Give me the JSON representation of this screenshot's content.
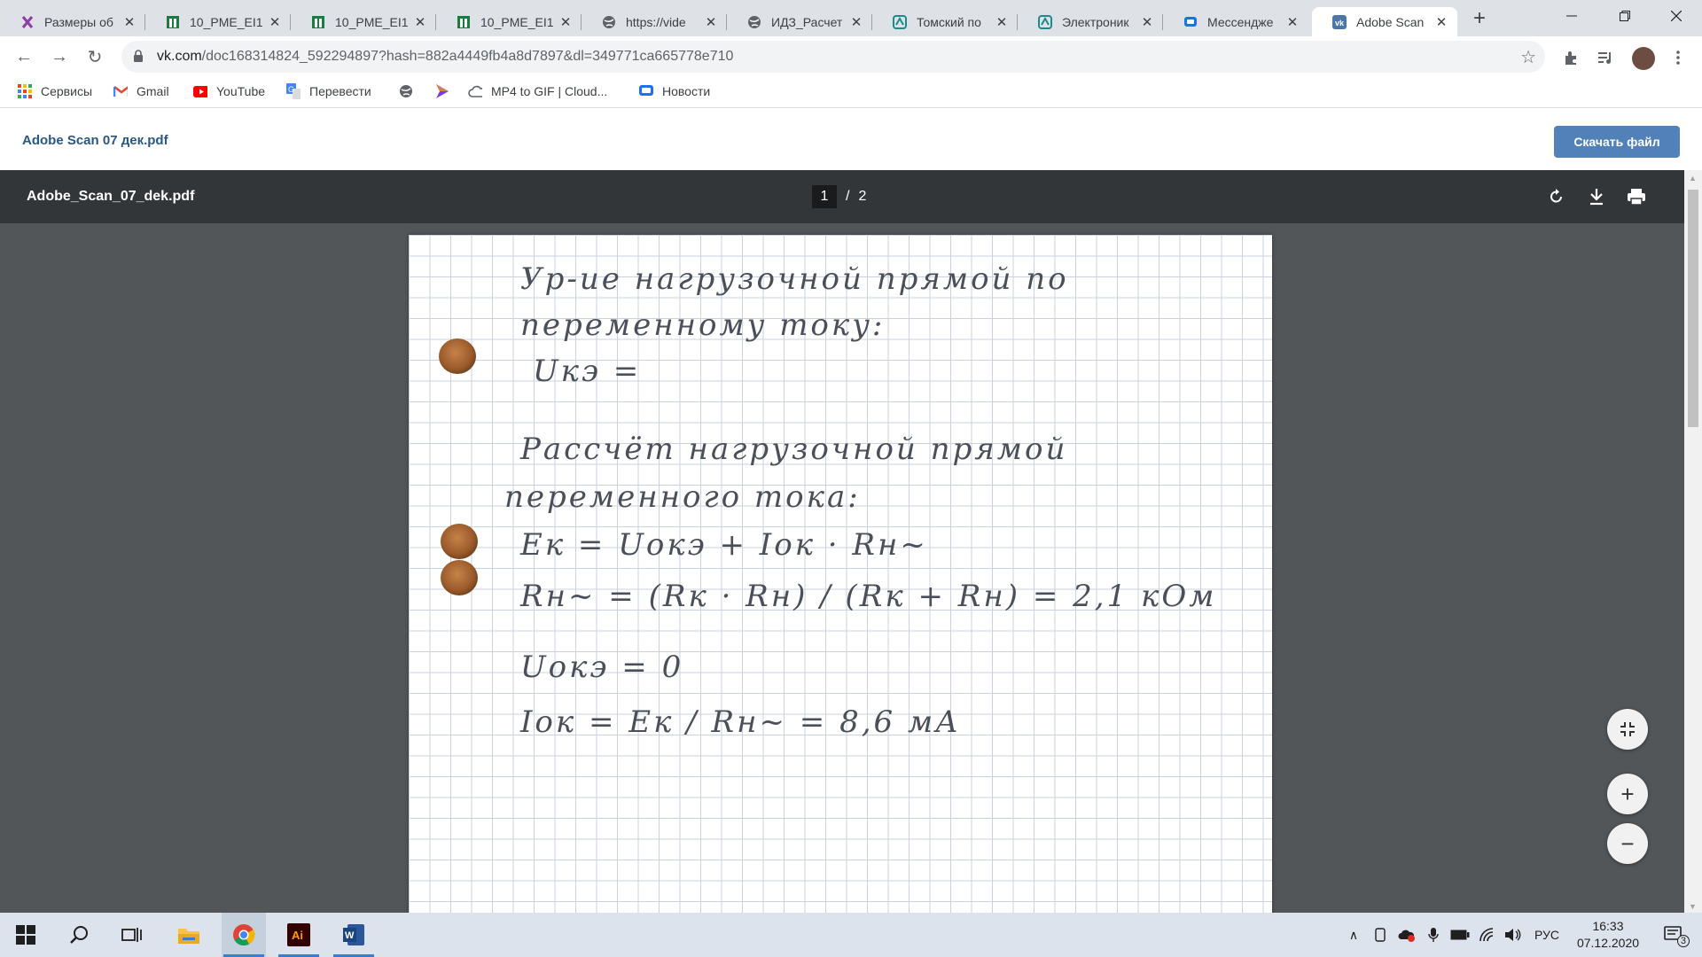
{
  "tabs": [
    {
      "title": "Размеры об",
      "icon": "purple-logo-icon"
    },
    {
      "title": "10_PME_EI1",
      "icon": "green-sheet-icon"
    },
    {
      "title": "10_PME_EI1",
      "icon": "green-sheet-icon"
    },
    {
      "title": "10_PME_EI1",
      "icon": "green-sheet-icon"
    },
    {
      "title": "https://vide",
      "icon": "globe-icon"
    },
    {
      "title": "ИДЗ_Расчет",
      "icon": "globe-icon"
    },
    {
      "title": "Томский по",
      "icon": "teal-logo-icon"
    },
    {
      "title": "Электроник",
      "icon": "teal-logo-icon"
    },
    {
      "title": "Мессендже",
      "icon": "chat-icon"
    },
    {
      "title": "Adobe Scan",
      "icon": "vk-icon"
    }
  ],
  "address": {
    "host": "vk.com",
    "path": "/doc168314824_592294897?hash=882a4449fb4a8d7897&dl=349771ca665778e710"
  },
  "bookmarks": [
    {
      "label": "Сервисы",
      "icon": "apps-grid-icon"
    },
    {
      "label": "Gmail",
      "icon": "gmail-icon"
    },
    {
      "label": "YouTube",
      "icon": "youtube-icon"
    },
    {
      "label": "Перевести",
      "icon": "translate-icon"
    },
    {
      "label": "",
      "icon": "globe-icon"
    },
    {
      "label": "",
      "icon": "purple-arrow-icon"
    },
    {
      "label": "MP4 to GIF | Cloud...",
      "icon": "cloud-icon"
    },
    {
      "label": "Новости",
      "icon": "chat-icon"
    }
  ],
  "vk": {
    "doc_title": "Adobe Scan 07 дек.pdf",
    "download_label": "Скачать файл"
  },
  "pdf": {
    "file_name": "Adobe_Scan_07_dek.pdf",
    "current_page": "1",
    "separator": "/",
    "total_pages": "2",
    "handwriting": [
      "Ур-ие нагрузочной прямой по",
      "переменному току:",
      "Uкэ =",
      "Рассчёт нагрузочной прямой",
      "переменного тока:",
      "Eк = Uокэ + Iок · Rн~",
      "Rн~ = (Rк · Rн) / (Rк + Rн) = 2,1 кОм",
      "Uокэ = 0",
      "Iок = Eк / Rн~ = 8,6 мА"
    ]
  },
  "taskbar": {
    "language": "РУС",
    "time": "16:33",
    "date": "07.12.2020",
    "notifications": "3"
  },
  "colors": {
    "vk_blue": "#5181b8",
    "viewer_bg": "#525659",
    "pdf_toolbar": "#323639",
    "taskbar_bg": "#dde3ec"
  }
}
